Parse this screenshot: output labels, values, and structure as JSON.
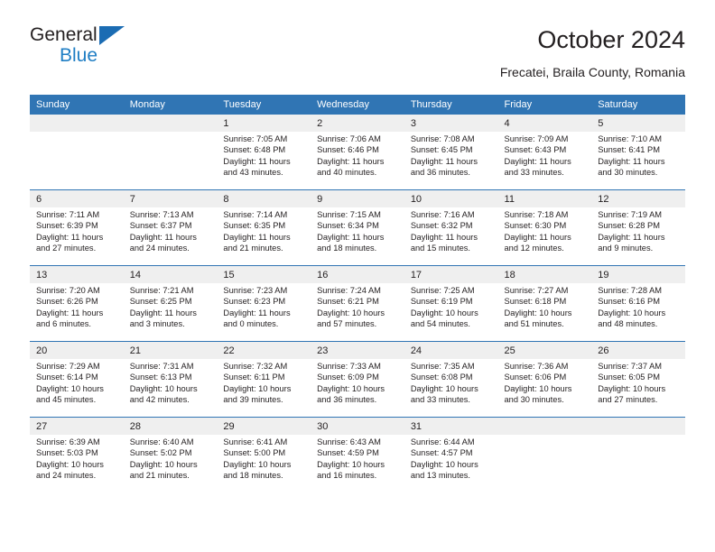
{
  "brand": {
    "name_top": "General",
    "name_bottom": "Blue",
    "triangle_color": "#1b6cb3",
    "accent_color": "#1f7ec4"
  },
  "header": {
    "title": "October 2024",
    "subtitle": "Frecatei, Braila County, Romania"
  },
  "theme": {
    "header_blue": "#3075b4",
    "daynum_band": "#efefef",
    "text": "#231f20"
  },
  "weekdays": [
    "Sunday",
    "Monday",
    "Tuesday",
    "Wednesday",
    "Thursday",
    "Friday",
    "Saturday"
  ],
  "labels": {
    "sunrise_prefix": "Sunrise: ",
    "sunset_prefix": "Sunset: ",
    "daylight_prefix": "Daylight: "
  },
  "weeks": [
    [
      {
        "day": "",
        "l1": "",
        "l2": "",
        "l3": "",
        "l4": ""
      },
      {
        "day": "",
        "l1": "",
        "l2": "",
        "l3": "",
        "l4": ""
      },
      {
        "day": "1",
        "l1": "Sunrise: 7:05 AM",
        "l2": "Sunset: 6:48 PM",
        "l3": "Daylight: 11 hours",
        "l4": "and 43 minutes."
      },
      {
        "day": "2",
        "l1": "Sunrise: 7:06 AM",
        "l2": "Sunset: 6:46 PM",
        "l3": "Daylight: 11 hours",
        "l4": "and 40 minutes."
      },
      {
        "day": "3",
        "l1": "Sunrise: 7:08 AM",
        "l2": "Sunset: 6:45 PM",
        "l3": "Daylight: 11 hours",
        "l4": "and 36 minutes."
      },
      {
        "day": "4",
        "l1": "Sunrise: 7:09 AM",
        "l2": "Sunset: 6:43 PM",
        "l3": "Daylight: 11 hours",
        "l4": "and 33 minutes."
      },
      {
        "day": "5",
        "l1": "Sunrise: 7:10 AM",
        "l2": "Sunset: 6:41 PM",
        "l3": "Daylight: 11 hours",
        "l4": "and 30 minutes."
      }
    ],
    [
      {
        "day": "6",
        "l1": "Sunrise: 7:11 AM",
        "l2": "Sunset: 6:39 PM",
        "l3": "Daylight: 11 hours",
        "l4": "and 27 minutes."
      },
      {
        "day": "7",
        "l1": "Sunrise: 7:13 AM",
        "l2": "Sunset: 6:37 PM",
        "l3": "Daylight: 11 hours",
        "l4": "and 24 minutes."
      },
      {
        "day": "8",
        "l1": "Sunrise: 7:14 AM",
        "l2": "Sunset: 6:35 PM",
        "l3": "Daylight: 11 hours",
        "l4": "and 21 minutes."
      },
      {
        "day": "9",
        "l1": "Sunrise: 7:15 AM",
        "l2": "Sunset: 6:34 PM",
        "l3": "Daylight: 11 hours",
        "l4": "and 18 minutes."
      },
      {
        "day": "10",
        "l1": "Sunrise: 7:16 AM",
        "l2": "Sunset: 6:32 PM",
        "l3": "Daylight: 11 hours",
        "l4": "and 15 minutes."
      },
      {
        "day": "11",
        "l1": "Sunrise: 7:18 AM",
        "l2": "Sunset: 6:30 PM",
        "l3": "Daylight: 11 hours",
        "l4": "and 12 minutes."
      },
      {
        "day": "12",
        "l1": "Sunrise: 7:19 AM",
        "l2": "Sunset: 6:28 PM",
        "l3": "Daylight: 11 hours",
        "l4": "and 9 minutes."
      }
    ],
    [
      {
        "day": "13",
        "l1": "Sunrise: 7:20 AM",
        "l2": "Sunset: 6:26 PM",
        "l3": "Daylight: 11 hours",
        "l4": "and 6 minutes."
      },
      {
        "day": "14",
        "l1": "Sunrise: 7:21 AM",
        "l2": "Sunset: 6:25 PM",
        "l3": "Daylight: 11 hours",
        "l4": "and 3 minutes."
      },
      {
        "day": "15",
        "l1": "Sunrise: 7:23 AM",
        "l2": "Sunset: 6:23 PM",
        "l3": "Daylight: 11 hours",
        "l4": "and 0 minutes."
      },
      {
        "day": "16",
        "l1": "Sunrise: 7:24 AM",
        "l2": "Sunset: 6:21 PM",
        "l3": "Daylight: 10 hours",
        "l4": "and 57 minutes."
      },
      {
        "day": "17",
        "l1": "Sunrise: 7:25 AM",
        "l2": "Sunset: 6:19 PM",
        "l3": "Daylight: 10 hours",
        "l4": "and 54 minutes."
      },
      {
        "day": "18",
        "l1": "Sunrise: 7:27 AM",
        "l2": "Sunset: 6:18 PM",
        "l3": "Daylight: 10 hours",
        "l4": "and 51 minutes."
      },
      {
        "day": "19",
        "l1": "Sunrise: 7:28 AM",
        "l2": "Sunset: 6:16 PM",
        "l3": "Daylight: 10 hours",
        "l4": "and 48 minutes."
      }
    ],
    [
      {
        "day": "20",
        "l1": "Sunrise: 7:29 AM",
        "l2": "Sunset: 6:14 PM",
        "l3": "Daylight: 10 hours",
        "l4": "and 45 minutes."
      },
      {
        "day": "21",
        "l1": "Sunrise: 7:31 AM",
        "l2": "Sunset: 6:13 PM",
        "l3": "Daylight: 10 hours",
        "l4": "and 42 minutes."
      },
      {
        "day": "22",
        "l1": "Sunrise: 7:32 AM",
        "l2": "Sunset: 6:11 PM",
        "l3": "Daylight: 10 hours",
        "l4": "and 39 minutes."
      },
      {
        "day": "23",
        "l1": "Sunrise: 7:33 AM",
        "l2": "Sunset: 6:09 PM",
        "l3": "Daylight: 10 hours",
        "l4": "and 36 minutes."
      },
      {
        "day": "24",
        "l1": "Sunrise: 7:35 AM",
        "l2": "Sunset: 6:08 PM",
        "l3": "Daylight: 10 hours",
        "l4": "and 33 minutes."
      },
      {
        "day": "25",
        "l1": "Sunrise: 7:36 AM",
        "l2": "Sunset: 6:06 PM",
        "l3": "Daylight: 10 hours",
        "l4": "and 30 minutes."
      },
      {
        "day": "26",
        "l1": "Sunrise: 7:37 AM",
        "l2": "Sunset: 6:05 PM",
        "l3": "Daylight: 10 hours",
        "l4": "and 27 minutes."
      }
    ],
    [
      {
        "day": "27",
        "l1": "Sunrise: 6:39 AM",
        "l2": "Sunset: 5:03 PM",
        "l3": "Daylight: 10 hours",
        "l4": "and 24 minutes."
      },
      {
        "day": "28",
        "l1": "Sunrise: 6:40 AM",
        "l2": "Sunset: 5:02 PM",
        "l3": "Daylight: 10 hours",
        "l4": "and 21 minutes."
      },
      {
        "day": "29",
        "l1": "Sunrise: 6:41 AM",
        "l2": "Sunset: 5:00 PM",
        "l3": "Daylight: 10 hours",
        "l4": "and 18 minutes."
      },
      {
        "day": "30",
        "l1": "Sunrise: 6:43 AM",
        "l2": "Sunset: 4:59 PM",
        "l3": "Daylight: 10 hours",
        "l4": "and 16 minutes."
      },
      {
        "day": "31",
        "l1": "Sunrise: 6:44 AM",
        "l2": "Sunset: 4:57 PM",
        "l3": "Daylight: 10 hours",
        "l4": "and 13 minutes."
      },
      {
        "day": "",
        "l1": "",
        "l2": "",
        "l3": "",
        "l4": ""
      },
      {
        "day": "",
        "l1": "",
        "l2": "",
        "l3": "",
        "l4": ""
      }
    ]
  ]
}
